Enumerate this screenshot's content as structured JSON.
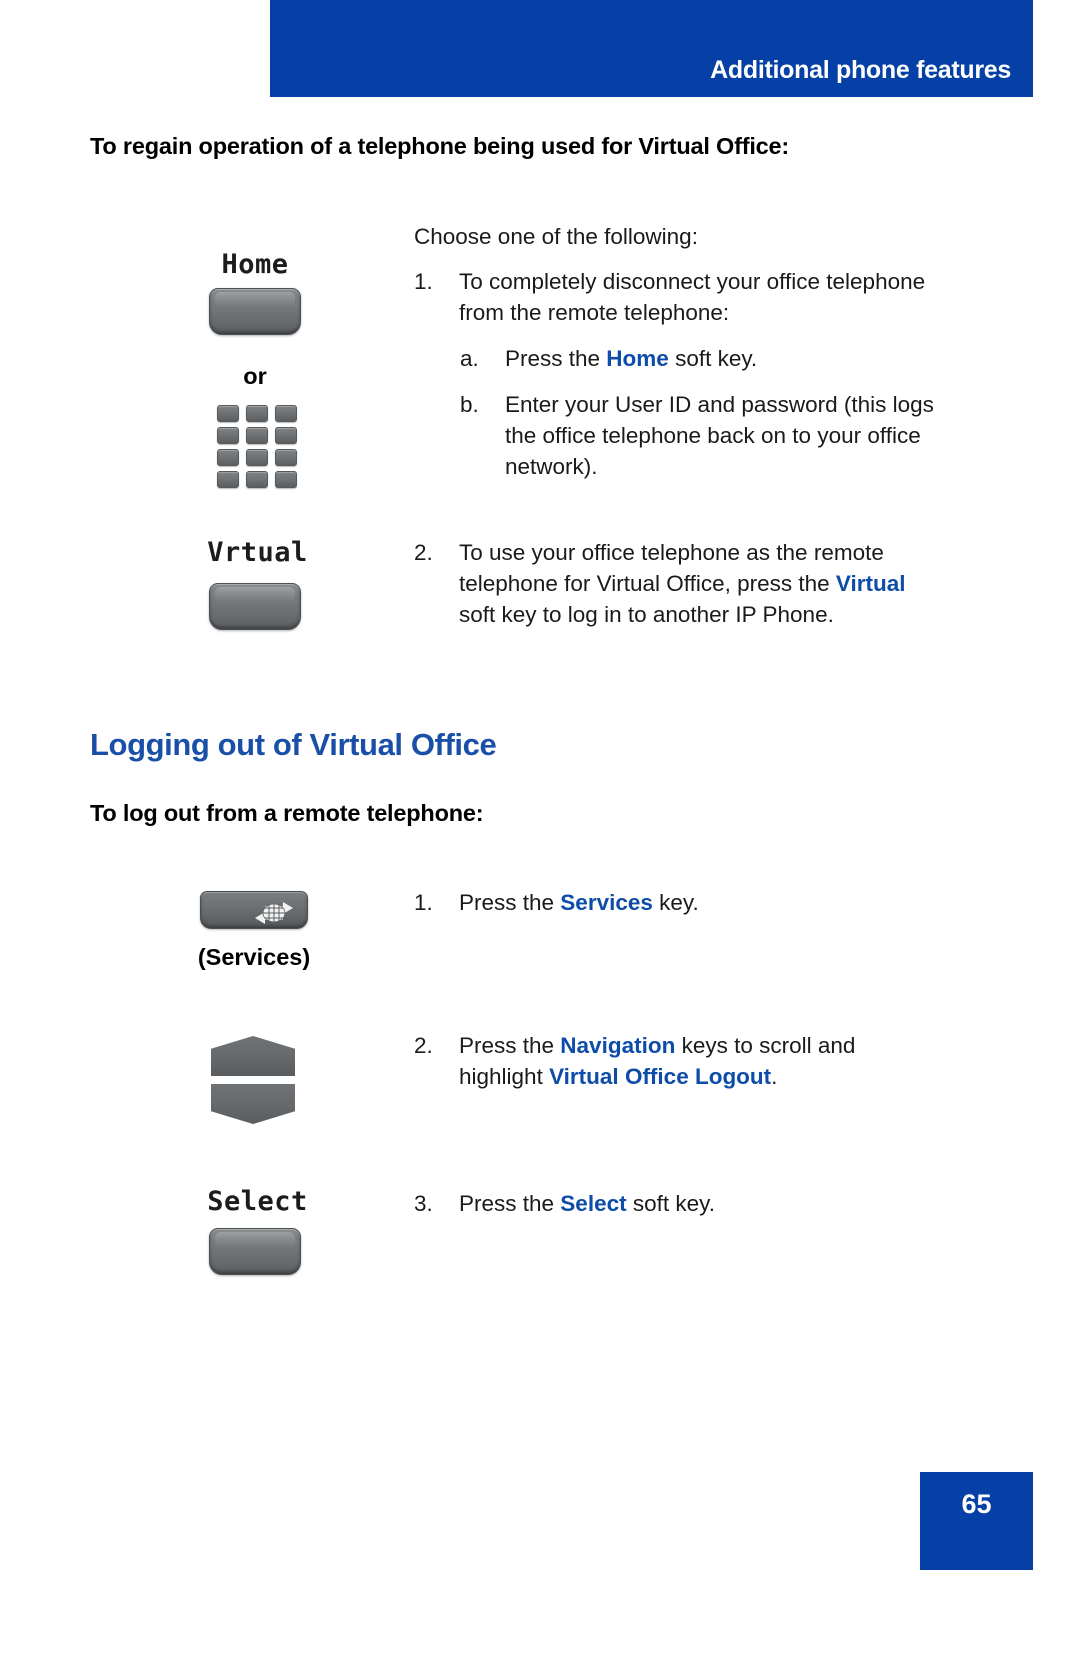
{
  "header": {
    "title": "Additional phone features",
    "bar_color": "#0540a6"
  },
  "section_regain": {
    "lead": "To regain operation of a telephone being used for Virtual Office:",
    "intro": "Choose one of the following:",
    "icons": {
      "home_label": "Home",
      "or_word": "or",
      "virtual_label": "Vrtual",
      "home_key_name": "home-soft-key",
      "keypad_name": "dialpad-keys",
      "virtual_key_name": "virtual-soft-key"
    },
    "steps": [
      {
        "marker": "1.",
        "text_pre": "To completely disconnect your office telephone from the remote telephone:",
        "substeps": [
          {
            "marker": "a.",
            "pre": "Press the ",
            "emph": "Home",
            "post": " soft key."
          },
          {
            "marker": "b.",
            "pre": "Enter your User ID and password (this logs the office telephone back on to your office network).",
            "emph": "",
            "post": ""
          }
        ]
      },
      {
        "marker": "2.",
        "pre": "To use your office telephone as the remote telephone for Virtual Office, press the ",
        "emph": "Virtual",
        "post": " soft key to log in to another IP Phone."
      }
    ]
  },
  "section_logout": {
    "heading": "Logging out of Virtual Office",
    "lead": "To log out from a remote telephone:",
    "steps": [
      {
        "marker": "1.",
        "pre": "Press the ",
        "emph": "Services",
        "post": " key.",
        "icon_caption": "(Services)",
        "icon_name": "services-key"
      },
      {
        "marker": "2.",
        "pre": "Press the ",
        "emph": "Navigation",
        "mid": " keys to scroll and highlight ",
        "emph2": "Virtual Office Logout",
        "post": ".",
        "icon_name": "navigation-keys"
      },
      {
        "marker": "3.",
        "pre": "Press the ",
        "emph": "Select",
        "post": " soft key.",
        "lcd_label": "Select",
        "icon_name": "select-soft-key"
      }
    ]
  },
  "footer": {
    "page_number": "65",
    "bar_color": "#0540a6"
  },
  "colors": {
    "brand_blue": "#0540a6",
    "heading_blue": "#1a4fa8",
    "emphasis_blue": "#0d4ca8",
    "key_gray": "#6e7274"
  }
}
